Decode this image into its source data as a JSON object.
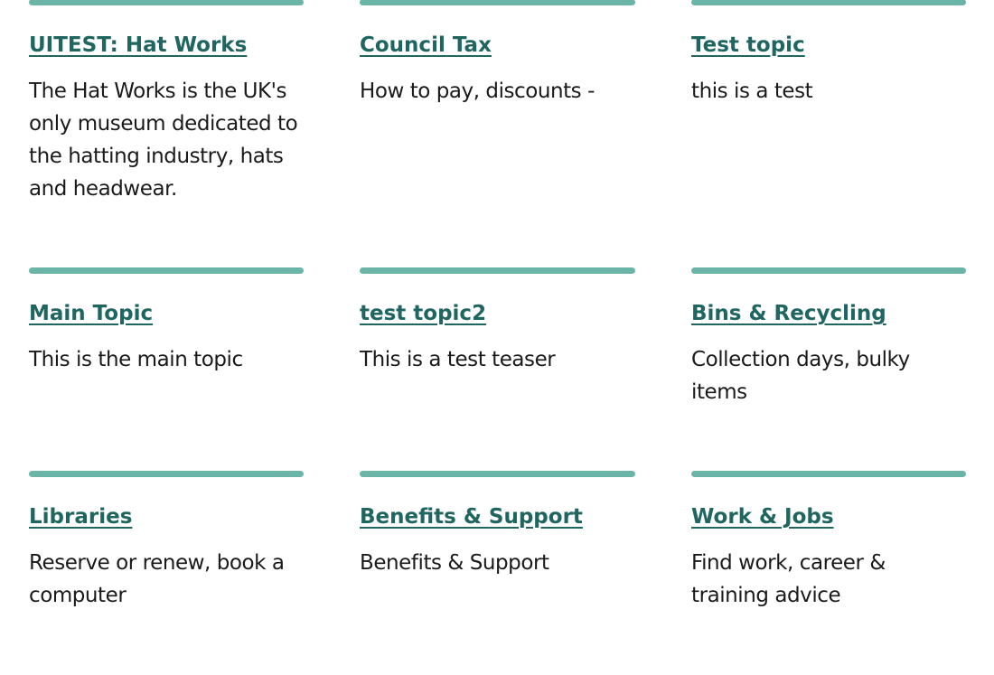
{
  "accent_color": "#6ab5a7",
  "link_color": "#1f6560",
  "topics": [
    {
      "title": "UITEST: Hat Works",
      "teaser": "The Hat Works is the UK's only museum dedicated to the hatting industry, hats and headwear."
    },
    {
      "title": "Council Tax",
      "teaser": "How to pay, discounts -"
    },
    {
      "title": "Test topic",
      "teaser": "this is a test"
    },
    {
      "title": "Main Topic",
      "teaser": "This is the main topic"
    },
    {
      "title": "test topic2",
      "teaser": "This is a test teaser"
    },
    {
      "title": "Bins & Recycling",
      "teaser": "Collection days, bulky items"
    },
    {
      "title": "Libraries",
      "teaser": "Reserve or renew, book a computer"
    },
    {
      "title": "Benefits & Support",
      "teaser": "Benefits & Support"
    },
    {
      "title": "Work & Jobs",
      "teaser": "Find work, career & training advice"
    }
  ]
}
